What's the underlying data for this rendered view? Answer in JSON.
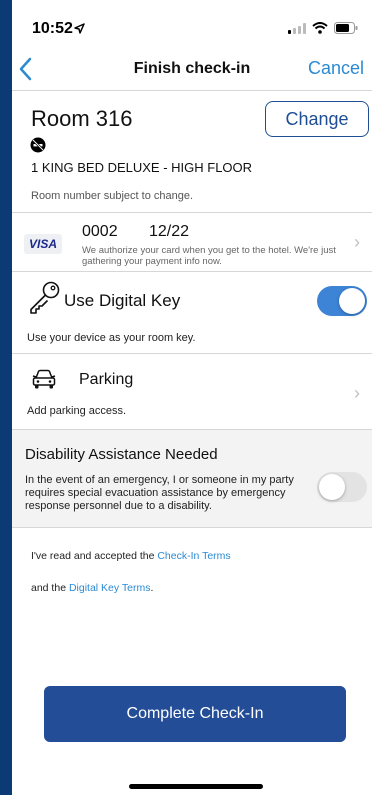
{
  "status_bar": {
    "time": "10:52"
  },
  "nav": {
    "title": "Finish check-in",
    "cancel_label": "Cancel"
  },
  "room": {
    "title": "Room 316",
    "change_label": "Change",
    "type": "1 KING BED DELUXE - HIGH FLOOR",
    "note": "Room number subject to change.",
    "icons": [
      "no-smoking-icon"
    ]
  },
  "payment": {
    "card_brand": "VISA",
    "card_number": "0002",
    "expiry": "12/22",
    "note": "We authorize your card when you get to the hotel. We're just gathering your payment info now."
  },
  "digital_key": {
    "label": "Use Digital Key",
    "subtitle": "Use your device as your room key.",
    "enabled": true
  },
  "parking": {
    "label": "Parking",
    "subtitle": "Add parking access."
  },
  "disability": {
    "title": "Disability Assistance Needed",
    "text": "In the event of an emergency, I or someone in my party requires special evacuation assistance by emergency response personnel due to a disability.",
    "enabled": false
  },
  "terms": {
    "line1_prefix": "I've read and accepted the ",
    "line1_link": "Check-In Terms",
    "line2_prefix": "and the ",
    "line2_link": "Digital Key Terms",
    "line2_suffix": "."
  },
  "cta": {
    "label": "Complete Check-In"
  },
  "colors": {
    "brand": "#234d96",
    "link": "#2c8ad3",
    "toggle_on": "#3d84d6",
    "background": "#0b3a74"
  }
}
